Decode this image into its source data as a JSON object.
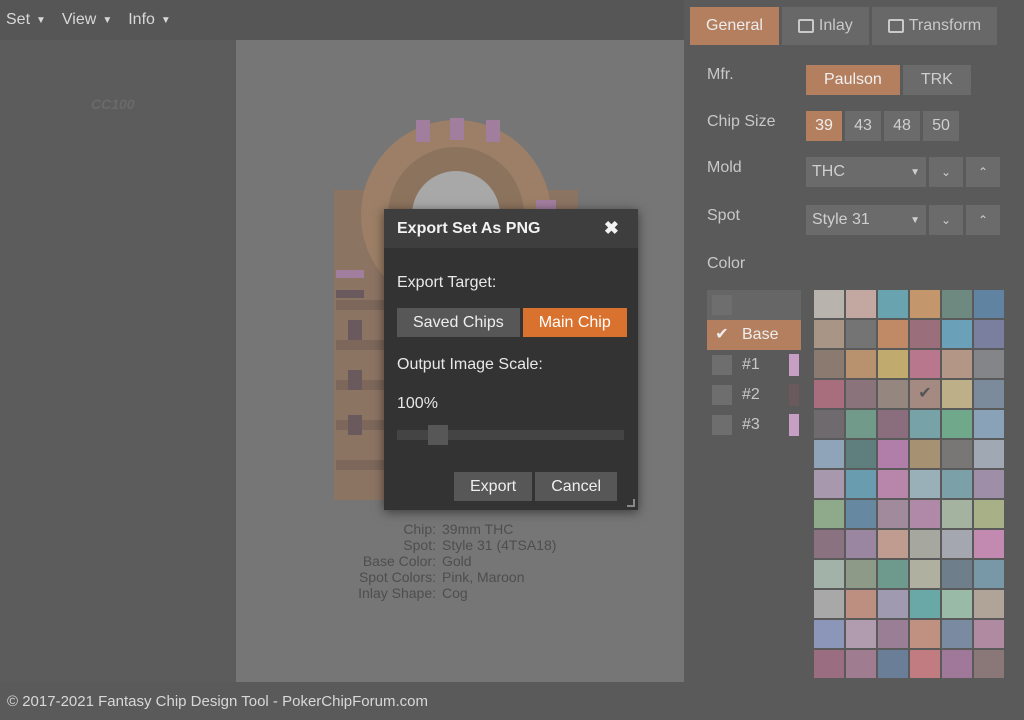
{
  "menu": [
    {
      "label": "Set"
    },
    {
      "label": "View"
    },
    {
      "label": "Info"
    }
  ],
  "watermark_label": "CC100",
  "chip_info": [
    {
      "key": "Chip:",
      "value": "39mm  THC"
    },
    {
      "key": "Spot:",
      "value": "Style 31 (4TSA18)"
    },
    {
      "key": "Base Color:",
      "value": "Gold"
    },
    {
      "key": "Spot Colors:",
      "value": "Pink, Maroon"
    },
    {
      "key": "Inlay Shape:",
      "value": "Cog"
    }
  ],
  "tabs": [
    {
      "label": "General",
      "active": true
    },
    {
      "label": "Inlay",
      "icon": "image-icon"
    },
    {
      "label": "Transform",
      "icon": "transform-icon"
    }
  ],
  "props": {
    "mfr_label": "Mfr.",
    "mfr_options": [
      "Paulson",
      "TRK"
    ],
    "mfr_selected": "Paulson",
    "size_label": "Chip Size",
    "size_options": [
      "39",
      "43",
      "48",
      "50"
    ],
    "size_selected": "39",
    "mold_label": "Mold",
    "mold_value": "THC",
    "spot_label": "Spot",
    "spot_value": "Style 31",
    "color_label": "Color"
  },
  "color_slots": [
    {
      "label": "Base",
      "active": true
    },
    {
      "label": "#1",
      "swatch": "#c79ec4"
    },
    {
      "label": "#2",
      "swatch": "#6a5a5e"
    },
    {
      "label": "#3",
      "swatch": "#c79ec4"
    }
  ],
  "palette": [
    "#b8b3ad",
    "#c3a7a1",
    "#6aa3b0",
    "#c4966c",
    "#6e8a80",
    "#5f83a0",
    "#a99586",
    "#747474",
    "#c08a66",
    "#9a6f7b",
    "#6aa0b8",
    "#7a7fa0",
    "#8a7a70",
    "#b8926e",
    "#c0aa6e",
    "#b8778d",
    "#b49686",
    "#838589",
    "#a86e7e",
    "#8a737a",
    "#958680",
    "#a48a80",
    "#bdb088",
    "#7b8b9c",
    "#6e6a6e",
    "#729a8a",
    "#8a6e7e",
    "#76a2a8",
    "#6fa88a",
    "#8aa2b8",
    "#8fa4b8",
    "#5f7e7e",
    "#b07ea8",
    "#a69272",
    "#797776",
    "#a0a8b4",
    "#a898ae",
    "#6a9cb0",
    "#b885ab",
    "#9ab0b8",
    "#7ca0a8",
    "#9e8ea8",
    "#8eaa8a",
    "#6688a0",
    "#a08a9c",
    "#b088a8",
    "#a4b2a0",
    "#a8b088",
    "#8a7280",
    "#9a86a0",
    "#c09c90",
    "#a6a8a0",
    "#a4a6b0",
    "#c28ab0",
    "#a2b2a8",
    "#8e9a88",
    "#6e9a8e",
    "#b0b0a0",
    "#6e7e8a",
    "#7898a8",
    "#a8a8a8",
    "#bc8f80",
    "#a09ab0",
    "#6aa8a8",
    "#9abaa8",
    "#b0a498",
    "#8c96b8",
    "#b09cae",
    "#9a7e96",
    "#c09080",
    "#7a8aa0",
    "#b08aa0",
    "#9a6e80",
    "#a07c90",
    "#6a7e98",
    "#c07c80",
    "#a0789a",
    "#8a7878"
  ],
  "palette_checked_index": 21,
  "footer_text": "© 2017-2021 Fantasy Chip Design Tool - PokerChipForum.com",
  "modal": {
    "title": "Export Set As PNG",
    "target_label": "Export Target:",
    "target_options": [
      "Saved Chips",
      "Main Chip"
    ],
    "target_selected": "Main Chip",
    "scale_label": "Output Image Scale:",
    "scale_value": "100%",
    "scale_fraction": 0.15,
    "export_label": "Export",
    "cancel_label": "Cancel"
  }
}
